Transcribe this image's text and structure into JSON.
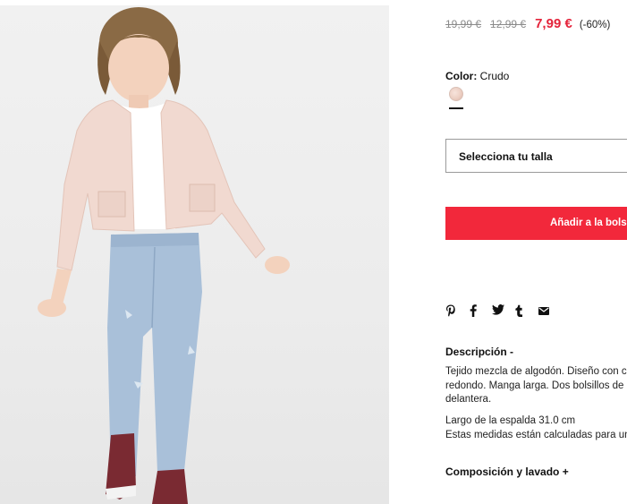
{
  "product": {
    "image": {
      "alt_icon": "product-photo"
    },
    "price": {
      "original": "19,99 €",
      "previous": "12,99 €",
      "current": "7,99 €",
      "discount": "(-60%)"
    },
    "color": {
      "label": "Color:",
      "value": "Crudo",
      "swatch_color": "#eccfc3"
    },
    "size_select": {
      "placeholder": "Selecciona tu talla"
    },
    "add_to_bag": {
      "label": "Añadir a la bolsa"
    },
    "share_icons": [
      "pinterest-icon",
      "facebook-icon",
      "twitter-icon",
      "tumblr-icon",
      "email-icon"
    ],
    "description": {
      "title": "Descripción -",
      "text": "Tejido mezcla de algodón. Diseño con cuello redondo. Manga larga. Dos bolsillos de parche delantera.",
      "measure_1": "Largo de la espalda 31.0 cm",
      "measure_2": "Estas medidas están calculadas para una talla"
    },
    "composition": {
      "title": "Composición y lavado +"
    }
  },
  "colors": {
    "accent_red": "#f2283b",
    "price_red": "#e4243b",
    "text": "#111111"
  }
}
